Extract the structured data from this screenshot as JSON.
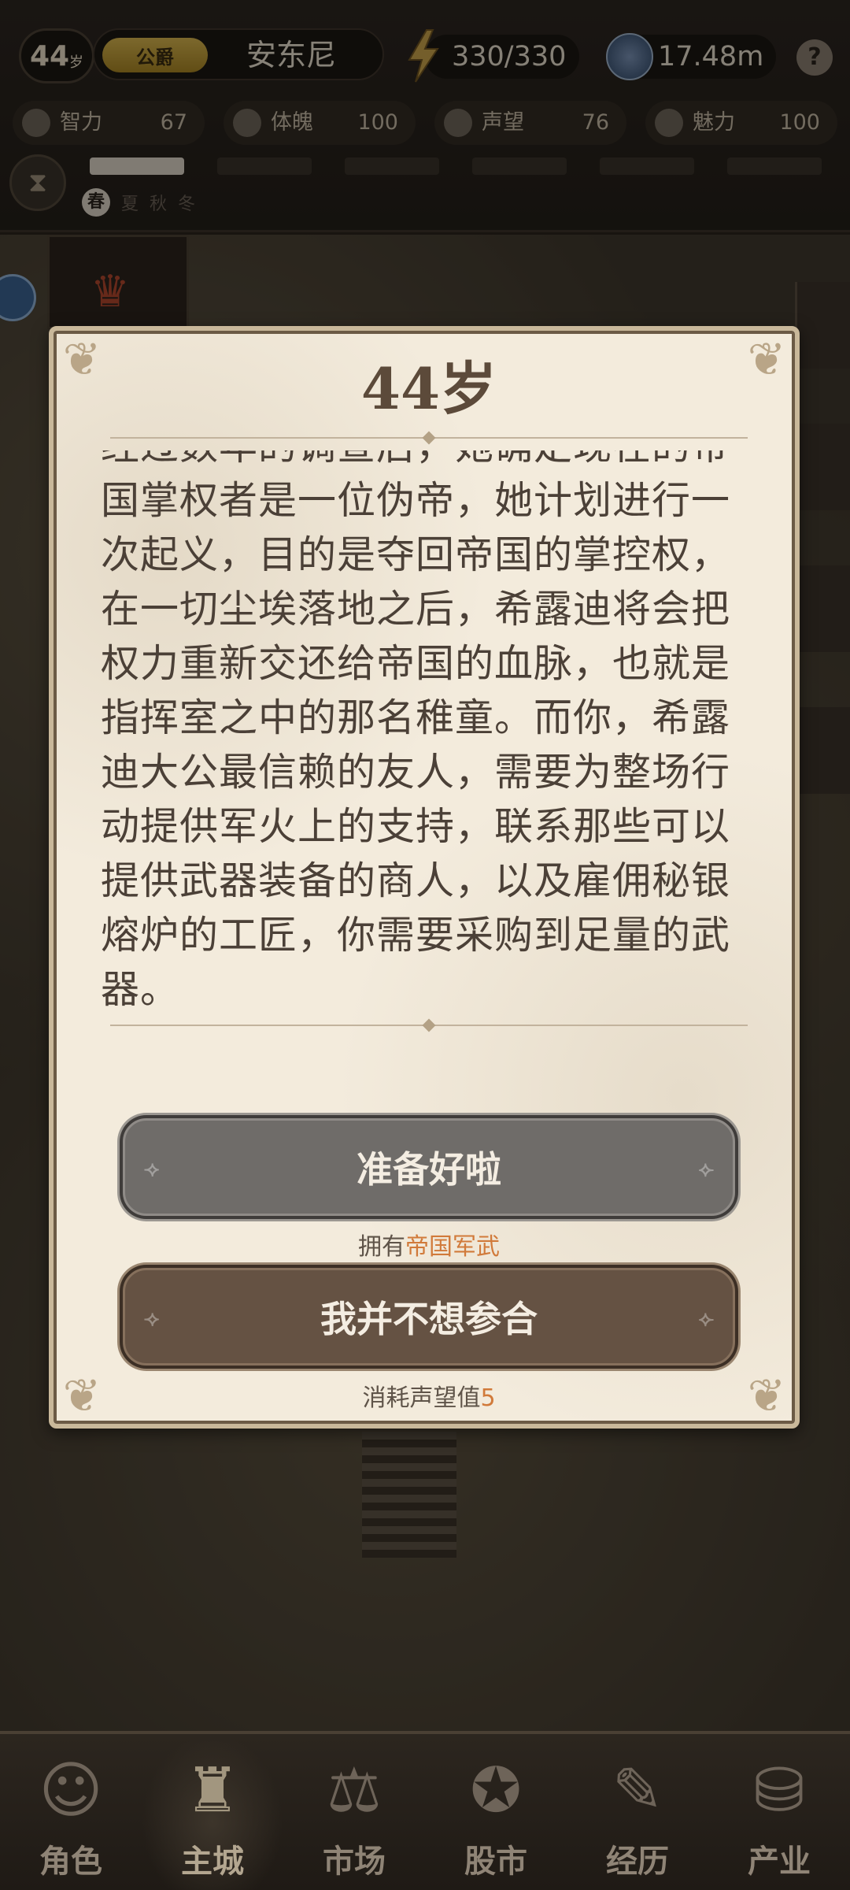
{
  "hud": {
    "age_num": "44",
    "age_unit": "岁",
    "title_badge": "公爵",
    "player_name": "安东尼",
    "energy": "330/330",
    "money": "17.48m",
    "help_icon": "question-icon",
    "stats": [
      {
        "label": "智力",
        "value": "67",
        "icon": "brain-icon"
      },
      {
        "label": "体魄",
        "value": "100",
        "icon": "muscle-icon"
      },
      {
        "label": "声望",
        "value": "76",
        "icon": "laurel-icon"
      },
      {
        "label": "魅力",
        "value": "100",
        "icon": "heart-pulse-icon"
      }
    ],
    "season_progress": 0.1,
    "seasons": [
      "春",
      "夏",
      "秋",
      "冬"
    ],
    "current_season": "春"
  },
  "dialog": {
    "title": "44岁",
    "story": "经过数年的调查后，她确定现在的帝国掌权者是一位伪帝，她计划进行一次起义，目的是夺回帝国的掌控权，在一切尘埃落地之后，希露迪将会把权力重新交还给帝国的血脉，也就是指挥室之中的那名稚童。而你，希露迪大公最信赖的友人，需要为整场行动提供军火上的支持，联系那些可以提供武器装备的商人，以及雇佣秘银熔炉的工匠，你需要采购到足量的武器。",
    "option1_label": "准备好啦",
    "option1_req_prefix": "拥有",
    "option1_req_item": "帝国军武",
    "option2_label": "我并不想参合",
    "option2_req_prefix": "消耗声望值",
    "option2_req_value": "5"
  },
  "nav": [
    {
      "label": "角色",
      "icon": "character-icon"
    },
    {
      "label": "主城",
      "icon": "castle-icon"
    },
    {
      "label": "市场",
      "icon": "scales-icon"
    },
    {
      "label": "股市",
      "icon": "stock-icon"
    },
    {
      "label": "经历",
      "icon": "scroll-icon"
    },
    {
      "label": "产业",
      "icon": "coins-icon"
    }
  ],
  "nav_active": "主城"
}
